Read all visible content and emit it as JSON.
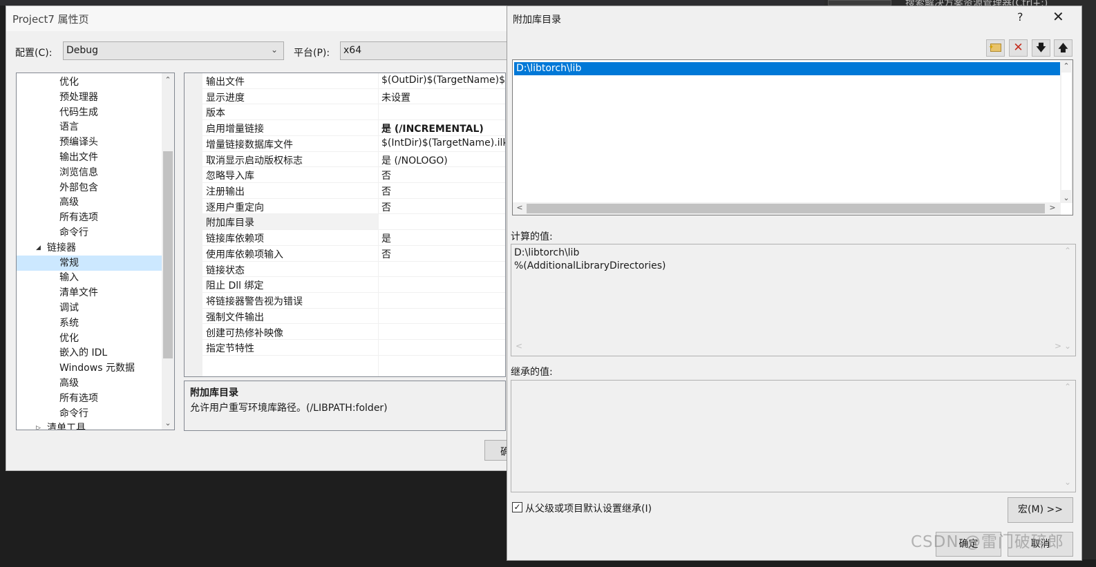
{
  "ide": {
    "search_hint": "搜索解决方案资源管理器(Ctrl+;)"
  },
  "property_pages": {
    "title": "Project7 属性页",
    "config_label": "配置(C):",
    "config_value": "Debug",
    "platform_label": "平台(P):",
    "platform_value": "x64",
    "tree_items": [
      {
        "label": "优化",
        "indent": 2
      },
      {
        "label": "预处理器",
        "indent": 2
      },
      {
        "label": "代码生成",
        "indent": 2
      },
      {
        "label": "语言",
        "indent": 2
      },
      {
        "label": "预编译头",
        "indent": 2
      },
      {
        "label": "输出文件",
        "indent": 2
      },
      {
        "label": "浏览信息",
        "indent": 2
      },
      {
        "label": "外部包含",
        "indent": 2
      },
      {
        "label": "高级",
        "indent": 2
      },
      {
        "label": "所有选项",
        "indent": 2
      },
      {
        "label": "命令行",
        "indent": 2
      },
      {
        "label": "链接器",
        "indent": 1,
        "expander": "◢"
      },
      {
        "label": "常规",
        "indent": 2,
        "selected": true
      },
      {
        "label": "输入",
        "indent": 2
      },
      {
        "label": "清单文件",
        "indent": 2
      },
      {
        "label": "调试",
        "indent": 2
      },
      {
        "label": "系统",
        "indent": 2
      },
      {
        "label": "优化",
        "indent": 2
      },
      {
        "label": "嵌入的 IDL",
        "indent": 2
      },
      {
        "label": "Windows 元数据",
        "indent": 2
      },
      {
        "label": "高级",
        "indent": 2
      },
      {
        "label": "所有选项",
        "indent": 2
      },
      {
        "label": "命令行",
        "indent": 2
      },
      {
        "label": "清单工具",
        "indent": 1,
        "expander": "▷"
      }
    ],
    "properties": [
      {
        "name": "输出文件",
        "value": "$(OutDir)$(TargetName)$"
      },
      {
        "name": "显示进度",
        "value": "未设置"
      },
      {
        "name": "版本",
        "value": ""
      },
      {
        "name": "启用增量链接",
        "value": "是 (/INCREMENTAL)",
        "bold": true
      },
      {
        "name": "增量链接数据库文件",
        "value": "$(IntDir)$(TargetName).ilk"
      },
      {
        "name": "取消显示启动版权标志",
        "value": "是 (/NOLOGO)"
      },
      {
        "name": "忽略导入库",
        "value": "否"
      },
      {
        "name": "注册输出",
        "value": "否"
      },
      {
        "name": "逐用户重定向",
        "value": "否"
      },
      {
        "name": "附加库目录",
        "value": "",
        "selected": true
      },
      {
        "name": "链接库依赖项",
        "value": "是"
      },
      {
        "name": "使用库依赖项输入",
        "value": "否"
      },
      {
        "name": "链接状态",
        "value": ""
      },
      {
        "name": "阻止 Dll 绑定",
        "value": ""
      },
      {
        "name": "将链接器警告视为错误",
        "value": ""
      },
      {
        "name": "强制文件输出",
        "value": ""
      },
      {
        "name": "创建可热修补映像",
        "value": ""
      },
      {
        "name": "指定节特性",
        "value": ""
      }
    ],
    "description_title": "附加库目录",
    "description_text": "允许用户重写环境库路径。(/LIBPATH:folder)",
    "ok_button_partial": "确"
  },
  "dialog": {
    "title": "附加库目录",
    "help": "?",
    "close": "✕",
    "toolbar": {
      "new_line_icon": "new-folder-icon",
      "delete_icon": "delete-icon",
      "move_down_icon": "arrow-down-icon",
      "move_up_icon": "arrow-up-icon"
    },
    "entries": [
      "D:\\libtorch\\lib"
    ],
    "evaluated_label": "计算的值:",
    "evaluated_lines": [
      "D:\\libtorch\\lib",
      "%(AdditionalLibraryDirectories)"
    ],
    "inherited_label": "继承的值:",
    "inherit_checkbox_label": "从父级或项目默认设置继承(I)",
    "inherit_checked": true,
    "macros_button": "宏(M) >>",
    "ok_button": "确定",
    "cancel_button": "取消"
  },
  "watermark": "CSDN @雷门破碎郎"
}
